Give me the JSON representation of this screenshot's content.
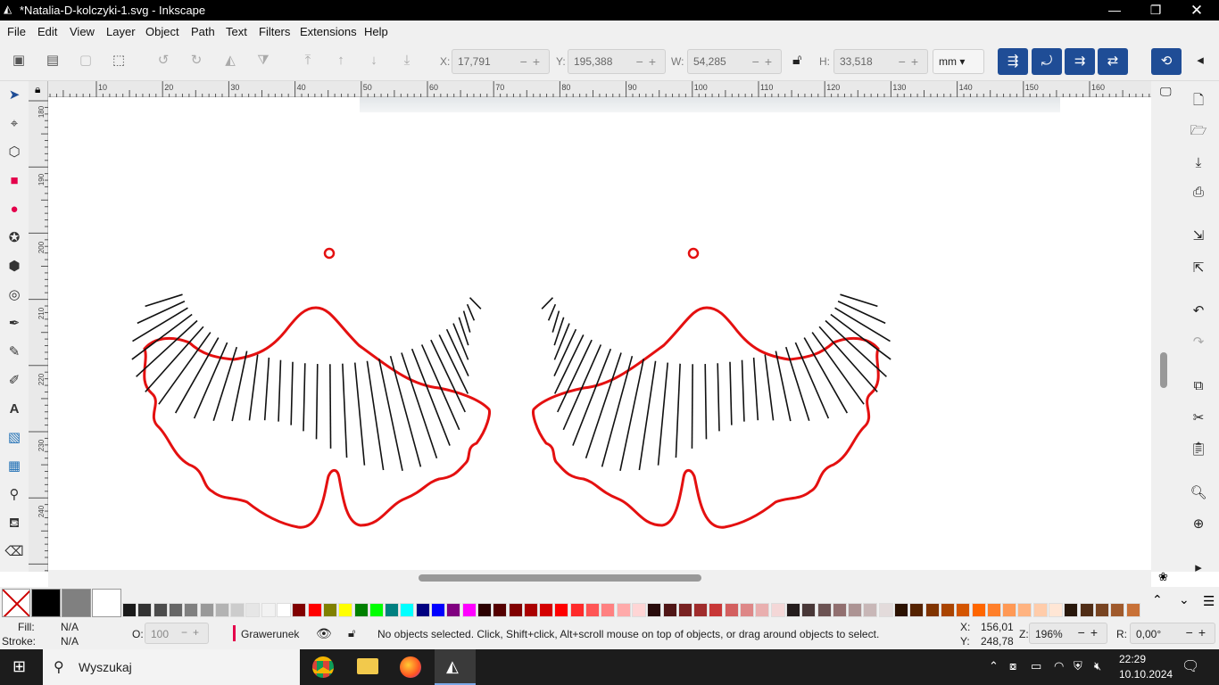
{
  "window": {
    "title": "*Natalia-D-kolczyki-1.svg - Inkscape"
  },
  "menu": [
    "File",
    "Edit",
    "View",
    "Layer",
    "Object",
    "Path",
    "Text",
    "Filters",
    "Extensions",
    "Help"
  ],
  "toolbar": {
    "x_label": "X:",
    "x_value": "17,791",
    "y_label": "Y:",
    "y_value": "195,388",
    "w_label": "W:",
    "w_value": "54,285",
    "h_label": "H:",
    "h_value": "33,518",
    "unit": "mm"
  },
  "ruler": {
    "h_ticks": [
      "10",
      "20",
      "30",
      "40",
      "50",
      "60",
      "70",
      "80",
      "90",
      "100",
      "110",
      "120",
      "130",
      "140",
      "150",
      "160"
    ],
    "v_ticks": [
      "180",
      "190",
      "200",
      "210",
      "220",
      "230",
      "240"
    ]
  },
  "colors": {
    "accent": "#1f4d96",
    "stroke_red": "#e41010"
  },
  "status": {
    "fill_label": "Fill:",
    "fill_value": "N/A",
    "stroke_label": "Stroke:",
    "stroke_value": "N/A",
    "opacity_label": "O:",
    "opacity_value": "100",
    "layer": "Grawerunek",
    "message": "No objects selected. Click, Shift+click, Alt+scroll mouse on top of objects, or drag around objects to select.",
    "cursor_x_label": "X:",
    "cursor_x": "156,01",
    "cursor_y_label": "Y:",
    "cursor_y": "248,78",
    "zoom_label": "Z:",
    "zoom": "196%",
    "rotation_label": "R:",
    "rotation": "0,00°"
  },
  "taskbar": {
    "search": "Wyszukaj",
    "time": "22:29",
    "date": "10.10.2024"
  },
  "palette": [
    "#000000",
    "#808080",
    "#ffffff",
    "#1a1a1a",
    "#333333",
    "#4d4d4d",
    "#666666",
    "#808080",
    "#999999",
    "#b3b3b3",
    "#cccccc",
    "#e6e6e6",
    "#f2f2f2",
    "#ffffff",
    "#800000",
    "#ff0000",
    "#808000",
    "#ffff00",
    "#008000",
    "#00ff00",
    "#008080",
    "#00ffff",
    "#000080",
    "#0000ff",
    "#800080",
    "#ff00ff",
    "#2b0000",
    "#550000",
    "#800000",
    "#aa0000",
    "#d40000",
    "#ff0000",
    "#ff2a2a",
    "#ff5555",
    "#ff8080",
    "#ffaaaa",
    "#ffd5d5",
    "#280b0b",
    "#501616",
    "#782121",
    "#a02c2c",
    "#c83737",
    "#d35f5f",
    "#de8787",
    "#e9afaf",
    "#f4d7d7",
    "#241c1c",
    "#483737",
    "#6c5353",
    "#916f6f",
    "#ac9393",
    "#c8b7b7",
    "#e3dbdb",
    "#2b1100",
    "#552200",
    "#803300",
    "#aa4400",
    "#d45500",
    "#ff6600",
    "#ff7f2a",
    "#ff9955",
    "#ffb380",
    "#ffccaa",
    "#ffe6d5",
    "#28170b",
    "#502d16",
    "#784421",
    "#a05a2c",
    "#c87137"
  ]
}
